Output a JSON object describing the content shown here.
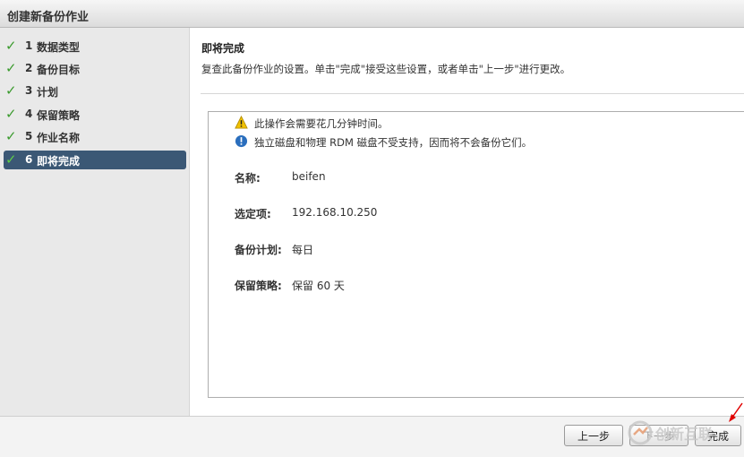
{
  "window": {
    "title": "创建新备份作业"
  },
  "steps": [
    {
      "num": "1",
      "label": "数据类型",
      "completed": true,
      "active": false
    },
    {
      "num": "2",
      "label": "备份目标",
      "completed": true,
      "active": false
    },
    {
      "num": "3",
      "label": "计划",
      "completed": true,
      "active": false
    },
    {
      "num": "4",
      "label": "保留策略",
      "completed": true,
      "active": false
    },
    {
      "num": "5",
      "label": "作业名称",
      "completed": true,
      "active": false
    },
    {
      "num": "6",
      "label": "即将完成",
      "completed": true,
      "active": true
    }
  ],
  "main": {
    "title": "即将完成",
    "description": "复查此备份作业的设置。单击\"完成\"接受这些设置，或者单击\"上一步\"进行更改。"
  },
  "notices": [
    {
      "icon": "warning-icon",
      "text": "此操作会需要花几分钟时间。"
    },
    {
      "icon": "info-icon",
      "text": "独立磁盘和物理 RDM 磁盘不受支持，因而将不会备份它们。"
    }
  ],
  "summary": {
    "name_label": "名称:",
    "name_value": "beifen",
    "target_label": "选定项:",
    "target_value": "192.168.10.250",
    "schedule_label": "备份计划:",
    "schedule_value": "每日",
    "retention_label": "保留策略:",
    "retention_value": "保留 60 天"
  },
  "footer": {
    "back_label": "上一步",
    "next_label": "下一步",
    "finish_label": "完成"
  },
  "watermark": {
    "text": "创新互联"
  },
  "colors": {
    "active_step_bg": "#3b5875",
    "check": "#3b9b2e",
    "warning": "#f2c200",
    "info": "#2a6ebd",
    "annotation_arrow": "#e00000"
  }
}
